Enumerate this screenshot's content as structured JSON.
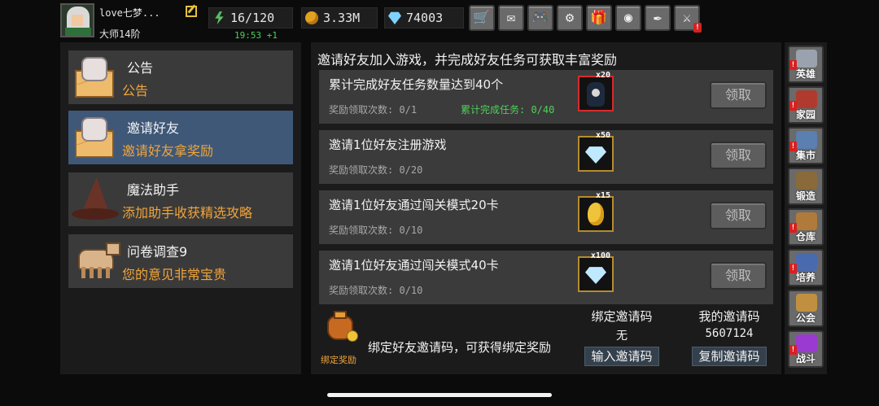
{
  "player": {
    "name": "love七梦...",
    "rank": "大师14阶"
  },
  "resources": {
    "energy": "16/120",
    "gold": "3.33M",
    "gems": "74003",
    "timer": "19:53 +1"
  },
  "top_buttons": [
    {
      "icon": "shop-cart-icon",
      "glyph": "🛒",
      "badge": ""
    },
    {
      "icon": "mail-icon",
      "glyph": "✉",
      "badge": ""
    },
    {
      "icon": "gamepad-icon",
      "glyph": "🎮",
      "badge": ""
    },
    {
      "icon": "settings-gear-icon",
      "glyph": "⚙",
      "badge": ""
    },
    {
      "icon": "gift-icon",
      "glyph": "🎁",
      "badge": ""
    },
    {
      "icon": "lucky-wheel-icon",
      "glyph": "◉",
      "badge": ""
    },
    {
      "icon": "feather-icon",
      "glyph": "✒",
      "badge": ""
    },
    {
      "icon": "crossed-swords-icon",
      "glyph": "⚔",
      "badge": "!"
    }
  ],
  "left_menu": [
    {
      "title": "公告",
      "subtitle": "公告",
      "icon": "announcement-letter-icon",
      "active": false
    },
    {
      "title": "邀请好友",
      "subtitle": "邀请好友拿奖励",
      "icon": "invite-letter-icon",
      "active": true
    },
    {
      "title": "魔法助手",
      "subtitle": "添加助手收获精选攻略",
      "icon": "wizard-hat-icon",
      "active": false
    },
    {
      "title": "问卷调查9",
      "subtitle": "您的意见非常宝贵",
      "icon": "camel-icon",
      "active": false
    }
  ],
  "main": {
    "title": "邀请好友加入游戏，并完成好友任务可获取丰富奖励",
    "tasks": [
      {
        "title": "累计完成好友任务数量达到40个",
        "count": "奖励领取次数: 0/1",
        "extra": "累计完成任务: 0/40",
        "reward_qty": "x20",
        "reward": "potion-icon",
        "button": "领取"
      },
      {
        "title": "邀请1位好友注册游戏",
        "count": "奖励领取次数: 0/20",
        "extra": "",
        "reward_qty": "x50",
        "reward": "diamond-icon",
        "button": "领取"
      },
      {
        "title": "邀请1位好友通过闯关模式20卡",
        "count": "奖励领取次数: 0/10",
        "extra": "",
        "reward_qty": "x15",
        "reward": "golden-egg-icon",
        "button": "领取"
      },
      {
        "title": "邀请1位好友通过闯关模式40卡",
        "count": "奖励领取次数: 0/10",
        "extra": "",
        "reward_qty": "x100",
        "reward": "diamond-icon",
        "button": "领取"
      }
    ],
    "bind": {
      "bag_label": "绑定奖励",
      "text": "绑定好友邀请码，可获得绑定奖励",
      "bound_label": "绑定邀请码",
      "bound_value": "无",
      "input_button": "输入邀请码",
      "my_label": "我的邀请码",
      "my_value": "5607124",
      "copy_button": "复制邀请码"
    }
  },
  "right_nav": [
    {
      "label": "英雄",
      "icon": "hero-helmet-icon",
      "color": "#9aa3ad",
      "alert": true
    },
    {
      "label": "家园",
      "icon": "home-castle-icon",
      "color": "#b03a2e",
      "alert": true
    },
    {
      "label": "集市",
      "icon": "market-stall-icon",
      "color": "#5a7fb0",
      "alert": true
    },
    {
      "label": "锻造",
      "icon": "anvil-hammer-icon",
      "color": "#8a6a3a",
      "alert": false
    },
    {
      "label": "仓库",
      "icon": "warehouse-icon",
      "color": "#b07a3a",
      "alert": true
    },
    {
      "label": "培养",
      "icon": "cultivation-trophy-icon",
      "color": "#4a6ab0",
      "alert": true
    },
    {
      "label": "公会",
      "icon": "guild-lion-icon",
      "color": "#c09040",
      "alert": false
    },
    {
      "label": "战斗",
      "icon": "battle-portal-icon",
      "color": "#9a3ad0",
      "alert": true
    }
  ]
}
